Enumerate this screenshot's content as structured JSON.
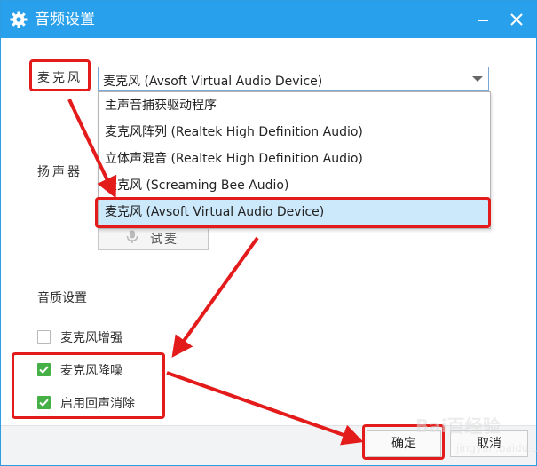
{
  "window": {
    "title": "音频设置"
  },
  "labels": {
    "microphone": "麦克风",
    "speaker": "扬声器",
    "audio_quality": "音质设置"
  },
  "mic_select": {
    "value": "麦克风 (Avsoft Virtual Audio Device)"
  },
  "mic_options": [
    {
      "label": "主声音捕获驱动程序",
      "selected": false
    },
    {
      "label": "麦克风阵列 (Realtek High Definition Audio)",
      "selected": false
    },
    {
      "label": "立体声混音 (Realtek High Definition Audio)",
      "selected": false
    },
    {
      "label": "麦克风 (Screaming Bee Audio)",
      "selected": false
    },
    {
      "label": "麦克风 (Avsoft Virtual Audio Device)",
      "selected": true
    }
  ],
  "test_button": {
    "label": "试麦"
  },
  "checkboxes": [
    {
      "label": "麦克风增强",
      "checked": false
    },
    {
      "label": "麦克风降噪",
      "checked": true
    },
    {
      "label": "启用回声消除",
      "checked": true
    }
  ],
  "footer": {
    "ok_label": "确定",
    "cancel_label": "取消"
  },
  "watermark": {
    "text": "Bai百经验",
    "sub": "jingyan.baidu.com"
  },
  "colors": {
    "titlebar": "#29a0ec",
    "annotation_red": "#e31b1b",
    "checkbox_green": "#45b046",
    "selected_item": "#cce8fb"
  }
}
